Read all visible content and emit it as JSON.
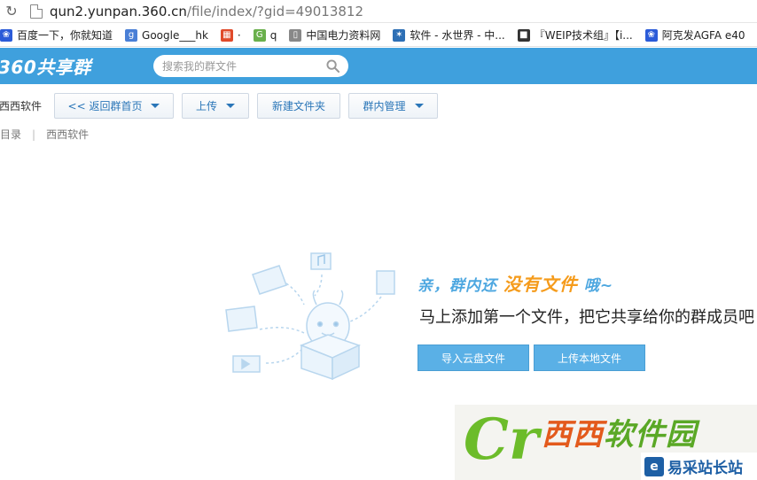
{
  "browser": {
    "url_host": "qun2.yunpan.360.cn",
    "url_path": "/file/index/?gid=49013812",
    "bookmarks": [
      {
        "label": "百度一下，你就知道",
        "icon": "paw-icon",
        "color": "#2b5bd8"
      },
      {
        "label": "Google___hk",
        "icon": "google-icon",
        "color": "#4a7fd6"
      },
      {
        "label": "·",
        "icon": "windows-icon",
        "color": "#e04a2a"
      },
      {
        "label": "q",
        "icon": "g-leaf-icon",
        "color": "#6ab04c"
      },
      {
        "label": "中国电力资料网",
        "icon": "page-icon",
        "color": "#888888"
      },
      {
        "label": "软件 - 水世界 - 中...",
        "icon": "star-icon",
        "color": "#2d6fb5"
      },
      {
        "label": "『WEIP技术组』【i...",
        "icon": "tech-icon",
        "color": "#333333"
      },
      {
        "label": "阿克发AGFA e40",
        "icon": "paw-icon",
        "color": "#2b5bd8"
      }
    ]
  },
  "header": {
    "logo": "360共享群",
    "search_placeholder": "搜索我的群文件",
    "bg_color": "#3fa0dd"
  },
  "toolbar": {
    "group_name": "西西软件",
    "back_label": "<< 返回群首页",
    "upload_label": "上传",
    "new_folder_label": "新建文件夹",
    "manage_label": "群内管理"
  },
  "breadcrumb": {
    "root": "目录",
    "current": "西西软件"
  },
  "empty_state": {
    "title_prefix": "亲，群内还",
    "title_highlight": "没有文件",
    "title_suffix": "哦~",
    "description": "马上添加第一个文件，把它共享给你的群成员吧",
    "import_button": "导入云盘文件",
    "upload_button": "上传本地文件"
  },
  "watermark": {
    "letter": "Cr",
    "brand_a": "西西",
    "brand_b": "软件园",
    "site_logo": "e",
    "site_name": "易采站长站"
  }
}
